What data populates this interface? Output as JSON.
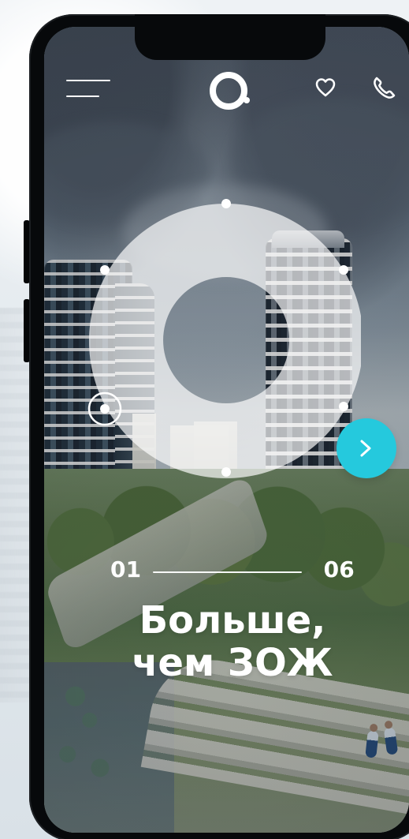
{
  "header": {
    "menu_icon": "menu-icon",
    "logo_icon": "brand-logo-icon",
    "favorites_icon": "heart-icon",
    "call_icon": "phone-icon"
  },
  "slider": {
    "current": "01",
    "total": "06",
    "progress": 0.1667
  },
  "hero": {
    "title_line_1": "Больше,",
    "title_line_2": "чем ЗОЖ"
  },
  "navigation": {
    "next_icon": "chevron-right-icon"
  },
  "colors": {
    "accent": "#25c9dd",
    "text": "#ffffff"
  }
}
